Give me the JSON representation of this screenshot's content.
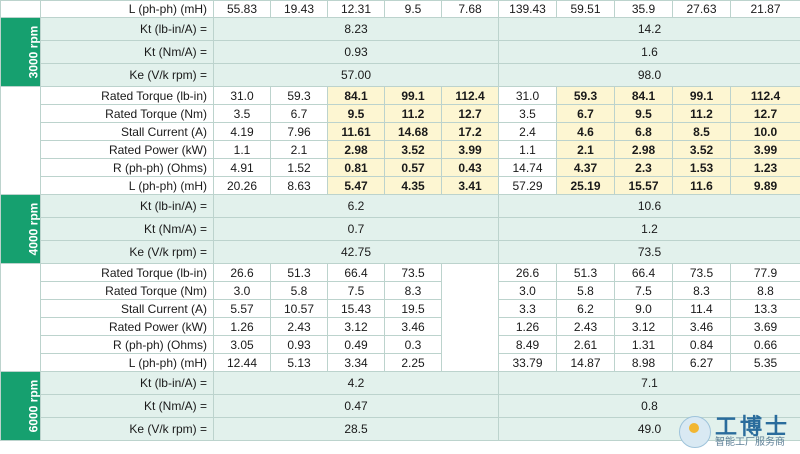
{
  "top_partial": {
    "label": "L (ph-ph) (mH)",
    "values": [
      "55.83",
      "19.43",
      "12.31",
      "9.5",
      "7.68",
      "139.43",
      "59.51",
      "35.9",
      "27.63",
      "21.87"
    ]
  },
  "sections": [
    {
      "rpm": "3000 rpm",
      "kt_rows": [
        {
          "label": "Kt (lb-in/A) =",
          "left": "8.23",
          "right": "14.2"
        },
        {
          "label": "Kt (Nm/A) =",
          "left": "0.93",
          "right": "1.6"
        },
        {
          "label": "Ke (V/k rpm) =",
          "left": "57.00",
          "right": "98.0"
        }
      ]
    },
    {
      "rows": [
        {
          "label": "Rated Torque (lb-in)",
          "values": [
            "31.0",
            "59.3",
            "84.1",
            "99.1",
            "112.4",
            "31.0",
            "59.3",
            "84.1",
            "99.1",
            "112.4"
          ]
        },
        {
          "label": "Rated Torque (Nm)",
          "values": [
            "3.5",
            "6.7",
            "9.5",
            "11.2",
            "12.7",
            "3.5",
            "6.7",
            "9.5",
            "11.2",
            "12.7"
          ]
        },
        {
          "label": "Stall Current (A)",
          "values": [
            "4.19",
            "7.96",
            "11.61",
            "14.68",
            "17.2",
            "2.4",
            "4.6",
            "6.8",
            "8.5",
            "10.0"
          ]
        },
        {
          "label": "Rated Power (kW)",
          "values": [
            "1.1",
            "2.1",
            "2.98",
            "3.52",
            "3.99",
            "1.1",
            "2.1",
            "2.98",
            "3.52",
            "3.99"
          ]
        },
        {
          "label": "R (ph-ph) (Ohms)",
          "values": [
            "4.91",
            "1.52",
            "0.81",
            "0.57",
            "0.43",
            "14.74",
            "4.37",
            "2.3",
            "1.53",
            "1.23"
          ]
        },
        {
          "label": "L (ph-ph) (mH)",
          "values": [
            "20.26",
            "8.63",
            "5.47",
            "4.35",
            "3.41",
            "57.29",
            "25.19",
            "15.57",
            "11.6",
            "9.89"
          ]
        }
      ]
    },
    {
      "rpm": "4000 rpm",
      "kt_rows": [
        {
          "label": "Kt (lb-in/A) =",
          "left": "6.2",
          "right": "10.6"
        },
        {
          "label": "Kt (Nm/A) =",
          "left": "0.7",
          "right": "1.2"
        },
        {
          "label": "Ke (V/k rpm) =",
          "left": "42.75",
          "right": "73.5"
        }
      ]
    },
    {
      "rows": [
        {
          "label": "Rated Torque (lb-in)",
          "values": [
            "26.6",
            "51.3",
            "66.4",
            "73.5",
            "",
            "26.6",
            "51.3",
            "66.4",
            "73.5",
            "77.9"
          ]
        },
        {
          "label": "Rated Torque (Nm)",
          "values": [
            "3.0",
            "5.8",
            "7.5",
            "8.3",
            "",
            "3.0",
            "5.8",
            "7.5",
            "8.3",
            "8.8"
          ]
        },
        {
          "label": "Stall Current (A)",
          "values": [
            "5.57",
            "10.57",
            "15.43",
            "19.5",
            "",
            "3.3",
            "6.2",
            "9.0",
            "11.4",
            "13.3"
          ]
        },
        {
          "label": "Rated Power (kW)",
          "values": [
            "1.26",
            "2.43",
            "3.12",
            "3.46",
            "",
            "1.26",
            "2.43",
            "3.12",
            "3.46",
            "3.69"
          ]
        },
        {
          "label": "R (ph-ph) (Ohms)",
          "values": [
            "3.05",
            "0.93",
            "0.49",
            "0.3",
            "",
            "8.49",
            "2.61",
            "1.31",
            "0.84",
            "0.66"
          ]
        },
        {
          "label": "L (ph-ph) (mH)",
          "values": [
            "12.44",
            "5.13",
            "3.34",
            "2.25",
            "",
            "33.79",
            "14.87",
            "8.98",
            "6.27",
            "5.35"
          ]
        }
      ]
    },
    {
      "rpm": "6000 rpm",
      "kt_rows": [
        {
          "label": "Kt (lb-in/A) =",
          "left": "4.2",
          "right": "7.1"
        },
        {
          "label": "Kt (Nm/A) =",
          "left": "0.47",
          "right": "0.8"
        },
        {
          "label": "Ke (V/k rpm) =",
          "left": "28.5",
          "right": "49.0"
        }
      ]
    }
  ],
  "watermark": {
    "title": "工博士",
    "subtitle": "智能工厂服务商"
  }
}
